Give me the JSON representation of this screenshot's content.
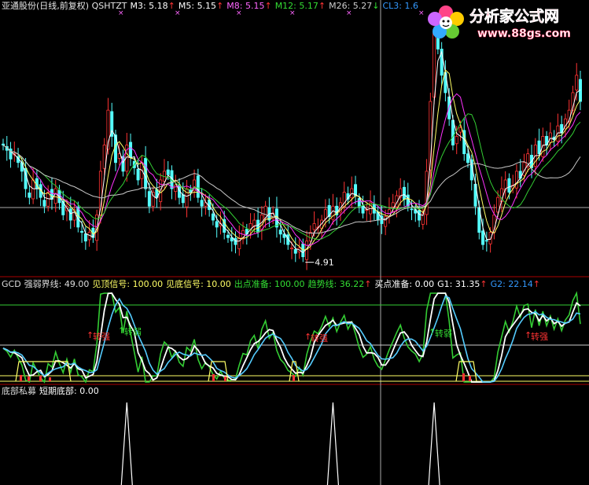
{
  "panel1": {
    "header": [
      {
        "text": "亚通股份(日线,前复权) QSHTZT",
        "color": "#e6e6e6"
      },
      {
        "text": "M3: 5.18",
        "color": "#ffffff",
        "arrow": "↑"
      },
      {
        "text": "M5: 5.15",
        "color": "#ffffff",
        "arrow": "↑"
      },
      {
        "text": "M8: 5.15",
        "color": "#ff66ff",
        "arrow": "↑"
      },
      {
        "text": "M12: 5.17",
        "color": "#33dd33",
        "arrow": "↑"
      },
      {
        "text": "M26: 5.27",
        "color": "#cccccc",
        "arrow": "↓"
      },
      {
        "text": "CL3: 1.6",
        "color": "#3399ff",
        "arrow": ""
      }
    ],
    "low_label": "4.91"
  },
  "panel2": {
    "header": [
      {
        "text": "GCD",
        "color": "#dddddd"
      },
      {
        "text": "强弱界线: 49.00",
        "color": "#dddddd"
      },
      {
        "text": "见顶信号: 100.00",
        "color": "#ffff66"
      },
      {
        "text": "见底信号: 10.00",
        "color": "#ffff66"
      },
      {
        "text": "出点准备: 100.00",
        "color": "#33dd33"
      },
      {
        "text": "趋势线: 36.22",
        "color": "#33dd33",
        "arrow": "↑"
      },
      {
        "text": "买点准备: 0.00",
        "color": "#ffffff"
      },
      {
        "text": "G1: 31.35",
        "color": "#ffffff",
        "arrow": "↑"
      },
      {
        "text": "G2: 22.14",
        "color": "#3399ff",
        "arrow": "↑"
      }
    ],
    "labels": [
      "转强",
      "转弱",
      "转强",
      "转弱",
      "转强"
    ]
  },
  "panel3": {
    "header": [
      {
        "text": "底部私募",
        "color": "#dddddd"
      },
      {
        "text": "短期底部: 0.00",
        "color": "#ffffff"
      }
    ]
  },
  "watermark": {
    "title": "分析家公式网",
    "url": "www.88gs.com"
  },
  "colors": {
    "up": "#ff3333",
    "down": "#54ffff",
    "ma_white": "#ffffff",
    "ma_yellow": "#ffff66",
    "ma_magenta": "#ff33ff",
    "ma_green": "#33cc33",
    "ma_gray": "#c8c8c8",
    "frame": "#aa0000"
  },
  "chart_data": [
    {
      "type": "candlestick",
      "title": "亚通股份(日线,前复权) QSHTZT",
      "series": [
        {
          "name": "M3",
          "last": 5.18
        },
        {
          "name": "M5",
          "last": 5.15
        },
        {
          "name": "M8",
          "last": 5.15
        },
        {
          "name": "M12",
          "last": 5.17
        },
        {
          "name": "M26",
          "last": 5.27
        }
      ],
      "annotations": [
        {
          "text": "4.91",
          "y": 4.91
        }
      ],
      "close": [
        5.55,
        5.52,
        5.47,
        5.5,
        5.45,
        5.4,
        5.3,
        5.25,
        5.35,
        5.3,
        5.25,
        5.2,
        5.28,
        5.24,
        5.3,
        5.22,
        5.15,
        5.2,
        5.12,
        5.18,
        5.08,
        5.05,
        5.0,
        5.05,
        5.02,
        5.15,
        5.4,
        5.55,
        5.75,
        5.6,
        5.45,
        5.5,
        5.4,
        5.55,
        5.48,
        5.42,
        5.35,
        5.45,
        5.3,
        5.2,
        5.28,
        5.25,
        5.35,
        5.4,
        5.38,
        5.3,
        5.32,
        5.25,
        5.22,
        5.3,
        5.28,
        5.35,
        5.25,
        5.2,
        5.22,
        5.18,
        5.12,
        5.08,
        5.1,
        5.05,
        5.02,
        5.0,
        4.98,
        5.02,
        5.06,
        5.04,
        5.1,
        5.12,
        5.05,
        5.15,
        5.2,
        5.12,
        5.16,
        5.08,
        5.04,
        5.02,
        4.98,
        4.96,
        4.93,
        4.96,
        4.91,
        5.0,
        5.05,
        5.1,
        5.08,
        5.12,
        5.18,
        5.14,
        5.2,
        5.15,
        5.22,
        5.28,
        5.24,
        5.3,
        5.26,
        5.2,
        5.16,
        5.18,
        5.22,
        5.16,
        5.12,
        5.1,
        5.14,
        5.18,
        5.22,
        5.26,
        5.3,
        5.24,
        5.2,
        5.18,
        5.16,
        5.12,
        5.16,
        5.4,
        5.8,
        6.2,
        6.1,
        5.95,
        5.85,
        5.7,
        5.55,
        5.6,
        5.65,
        5.5,
        5.45,
        5.35,
        5.2,
        5.05,
        4.98,
        5.0,
        5.05,
        5.15,
        5.25,
        5.3,
        5.35,
        5.28,
        5.32,
        5.4,
        5.36,
        5.45,
        5.5,
        5.42,
        5.55,
        5.5,
        5.6,
        5.55,
        5.62,
        5.58,
        5.66,
        5.62,
        5.7,
        5.75,
        5.85,
        5.95,
        5.8
      ]
    },
    {
      "type": "line",
      "title": "GCD",
      "ylim": [
        0,
        120
      ],
      "series": [
        {
          "name": "强弱界线",
          "last": 49.0
        },
        {
          "name": "见顶信号",
          "last": 100.0
        },
        {
          "name": "见底信号",
          "last": 10.0
        },
        {
          "name": "出点准备",
          "last": 100.0
        },
        {
          "name": "趋势线",
          "last": 36.22
        },
        {
          "name": "买点准备",
          "last": 0.0
        },
        {
          "name": "G1",
          "last": 31.35
        },
        {
          "name": "G2",
          "last": 22.14
        }
      ]
    },
    {
      "type": "line",
      "title": "底部私募",
      "ylim": [
        0,
        1
      ],
      "series": [
        {
          "name": "短期底部",
          "last": 0.0,
          "spikes": [
            33,
            88,
            115,
            186
          ]
        }
      ]
    }
  ]
}
